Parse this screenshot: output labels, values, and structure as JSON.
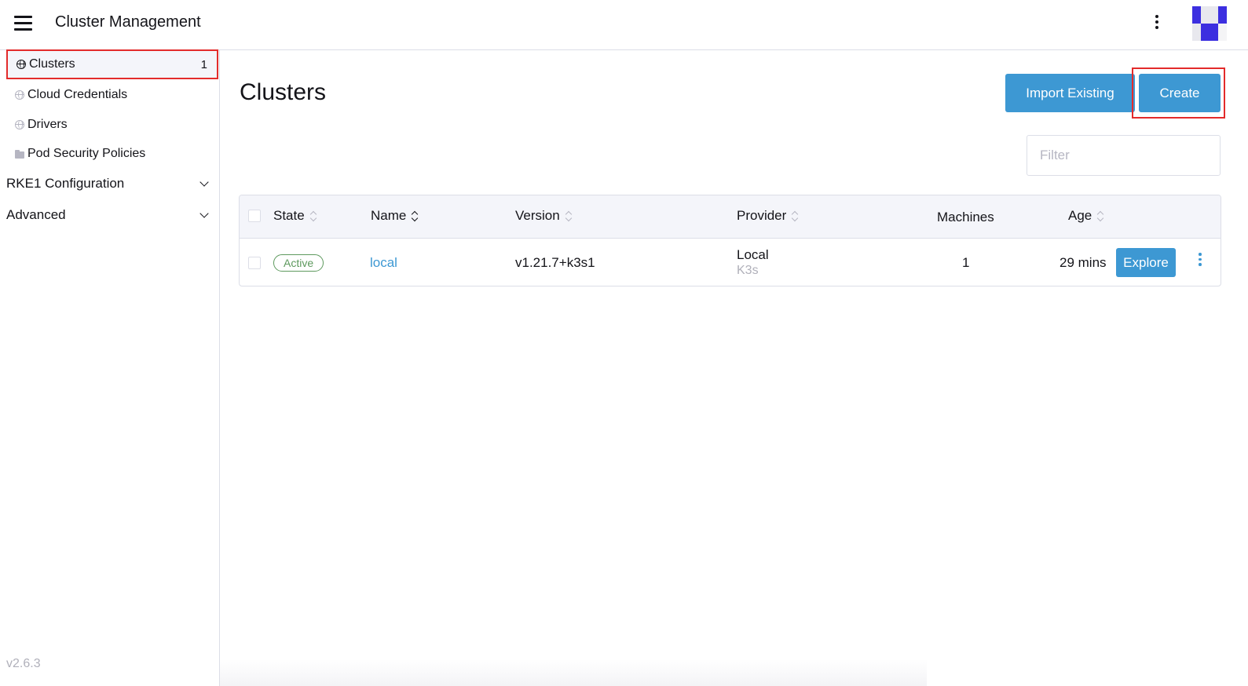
{
  "header": {
    "title": "Cluster Management",
    "menu_icon": "hamburger-icon",
    "more_icon": "vertical-ellipsis-icon",
    "avatar_colors": [
      "#3c2fe0",
      "#e8e8ee"
    ]
  },
  "sidebar": {
    "items": [
      {
        "label": "Clusters",
        "icon": "globe-icon",
        "count": "1",
        "active": true
      },
      {
        "label": "Cloud Credentials",
        "icon": "globe-icon"
      },
      {
        "label": "Drivers",
        "icon": "globe-icon"
      },
      {
        "label": "Pod Security Policies",
        "icon": "folder-icon"
      }
    ],
    "groups": [
      {
        "label": "RKE1 Configuration",
        "icon": "chevron-down-icon"
      },
      {
        "label": "Advanced",
        "icon": "chevron-down-icon"
      }
    ],
    "version": "v2.6.3"
  },
  "main": {
    "title": "Clusters",
    "import_label": "Import Existing",
    "create_label": "Create",
    "filter_placeholder": "Filter",
    "accent_color": "#3d98d3",
    "highlight_color": "#e32b2b"
  },
  "table": {
    "columns": {
      "state": "State",
      "name": "Name",
      "version": "Version",
      "provider": "Provider",
      "machines": "Machines",
      "age": "Age"
    },
    "rows": [
      {
        "state": "Active",
        "name": "local",
        "version": "v1.21.7+k3s1",
        "provider": "Local",
        "provider_sub": "K3s",
        "machines": "1",
        "age": "29 mins",
        "action": "Explore"
      }
    ]
  }
}
